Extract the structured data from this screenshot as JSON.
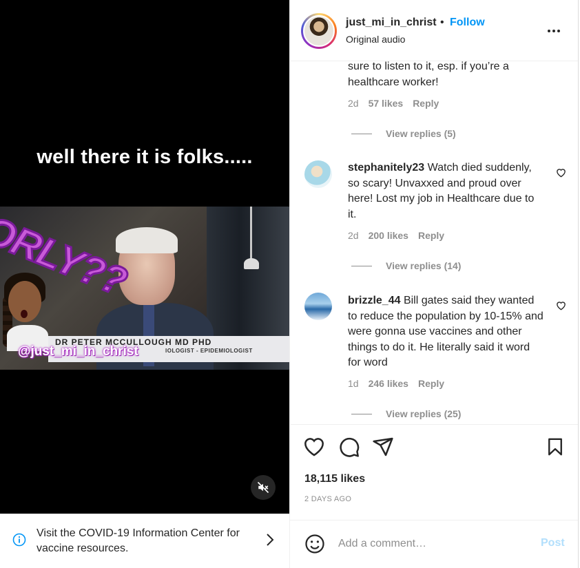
{
  "video": {
    "caption": "well there it is folks.....",
    "overlay_word": "ORLY??",
    "lower_third_name": "DR PETER MCCULLOUGH MD PHD",
    "lower_third_role": "IOLOGIST - EPIDEMIOLOGIST",
    "handle_tag": "@just_mi_in_christ"
  },
  "covid_banner": {
    "text": "Visit the COVID-19 Information Center for vaccine resources."
  },
  "header": {
    "username": "just_mi_in_christ",
    "separator": "•",
    "follow_label": "Follow",
    "audio": "Original audio"
  },
  "comments": [
    {
      "username": "",
      "text": "sure to listen to it, esp. if you’re a healthcare worker!",
      "age": "2d",
      "likes": "57 likes",
      "reply_label": "Reply",
      "view_replies": "View replies (5)"
    },
    {
      "username": "stephanitely23",
      "text": "Watch died suddenly, so scary! Unvaxxed and proud over here! Lost my job in Healthcare due to it.",
      "age": "2d",
      "likes": "200 likes",
      "reply_label": "Reply",
      "view_replies": "View replies (14)"
    },
    {
      "username": "brizzle_44",
      "text": "Bill gates said they wanted to reduce the population by 10-15% and were gonna use vaccines and other things to do it. He literally said it word for word",
      "age": "1d",
      "likes": "246 likes",
      "reply_label": "Reply",
      "view_replies": "View replies (25)"
    }
  ],
  "post": {
    "likes": "18,115 likes",
    "age": "2 DAYS AGO"
  },
  "add_comment": {
    "placeholder": "Add a comment…",
    "post_label": "Post"
  },
  "colors": {
    "accent": "#0095f6",
    "post_disabled": "#b2dffc",
    "muted": "#8e8e8e"
  }
}
